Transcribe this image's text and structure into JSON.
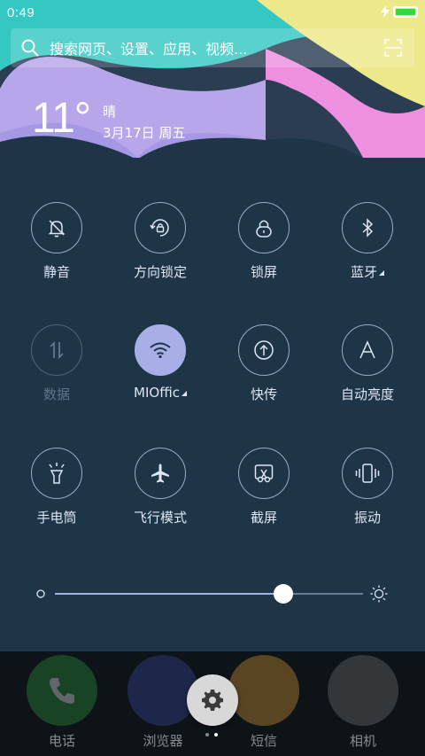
{
  "status": {
    "time": "0:49",
    "battery_level": 1.0,
    "battery_color": "#36d63f"
  },
  "search": {
    "placeholder": "搜索网页、设置、应用、视频..."
  },
  "weather": {
    "temperature": "11°",
    "condition": "晴",
    "date": "3月17日 周五"
  },
  "toggles": [
    {
      "label": "静音",
      "icon": "mute-bell-icon",
      "state": "off"
    },
    {
      "label": "方向锁定",
      "icon": "rotation-lock-icon",
      "state": "off"
    },
    {
      "label": "锁屏",
      "icon": "lock-icon",
      "state": "off"
    },
    {
      "label": "蓝牙",
      "icon": "bluetooth-icon",
      "state": "off",
      "has_menu": true
    },
    {
      "label": "数据",
      "icon": "mobile-data-icon",
      "state": "disabled"
    },
    {
      "label": "MIOffic",
      "icon": "wifi-icon",
      "state": "on",
      "has_menu": true
    },
    {
      "label": "快传",
      "icon": "quick-transfer-icon",
      "state": "off"
    },
    {
      "label": "自动亮度",
      "icon": "auto-brightness-icon",
      "state": "off"
    },
    {
      "label": "手电筒",
      "icon": "flashlight-icon",
      "state": "off"
    },
    {
      "label": "飞行模式",
      "icon": "airplane-icon",
      "state": "off"
    },
    {
      "label": "截屏",
      "icon": "screenshot-icon",
      "state": "off"
    },
    {
      "label": "振动",
      "icon": "vibrate-icon",
      "state": "off"
    }
  ],
  "brightness": {
    "level": 0.74
  },
  "dock": [
    {
      "label": "电话",
      "icon": "phone-icon",
      "color": "#2e9e3f"
    },
    {
      "label": "浏览器",
      "icon": "browser-globe-icon",
      "color": "#3b4ea6"
    },
    {
      "label": "短信",
      "icon": "messages-icon",
      "color": "#e8a23a"
    },
    {
      "label": "相机",
      "icon": "camera-icon",
      "color": "#7a7a7a"
    }
  ],
  "pages": {
    "count": 2,
    "current": 1
  },
  "colors": {
    "accent": "#a8aee6",
    "panel_bg": "#1d3547"
  }
}
